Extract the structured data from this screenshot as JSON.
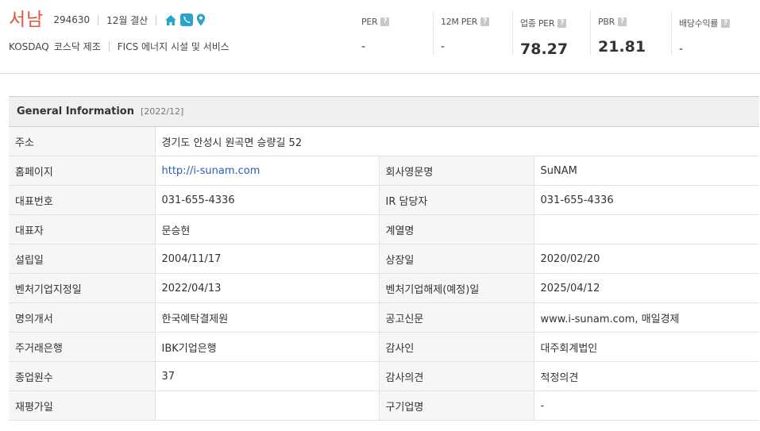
{
  "header": {
    "company_name": "서남",
    "code": "294630",
    "settlement": "12월 결산",
    "market": "KOSDAQ",
    "sector_a": "코스닥 제조",
    "sector_b": "FICS 에너지 시설 및 서비스"
  },
  "icons": {
    "home": "home-icon",
    "phone": "phone-icon",
    "map": "map-pin-icon"
  },
  "colors": {
    "company": "#e4533e",
    "link": "#2b5fb4",
    "section_bg": "#efefef"
  },
  "metrics": [
    {
      "label": "PER",
      "value": "-"
    },
    {
      "label": "12M PER",
      "value": "-"
    },
    {
      "label": "업종 PER",
      "value": "78.27"
    },
    {
      "label": "PBR",
      "value": "21.81"
    },
    {
      "label": "배당수익률",
      "value": "-"
    }
  ],
  "help_glyph": "?",
  "section": {
    "title": "General Information",
    "date": "[2022/12]"
  },
  "info": {
    "address_label": "주소",
    "address": "경기도 안성시 원곡면 승량길 52",
    "rows": [
      {
        "l1": "홈페이지",
        "v1": "http://i-sunam.com",
        "l2": "회사영문명",
        "v2": "SuNAM"
      },
      {
        "l1": "대표번호",
        "v1": "031-655-4336",
        "l2": "IR 담당자",
        "v2": "031-655-4336"
      },
      {
        "l1": "대표자",
        "v1": "문승현",
        "l2": "계열명",
        "v2": ""
      },
      {
        "l1": "설립일",
        "v1": "2004/11/17",
        "l2": "상장일",
        "v2": "2020/02/20"
      },
      {
        "l1": "벤처기업지정일",
        "v1": "2022/04/13",
        "l2": "벤처기업해제(예정)일",
        "v2": "2025/04/12"
      },
      {
        "l1": "명의개서",
        "v1": "한국예탁결제원",
        "l2": "공고신문",
        "v2": "www.i-sunam.com, 매일경제"
      },
      {
        "l1": "주거래은행",
        "v1": "IBK기업은행",
        "l2": "감사인",
        "v2": "대주회계법인"
      },
      {
        "l1": "종업원수",
        "v1": "37",
        "l2": "감사의견",
        "v2": "적정의견"
      },
      {
        "l1": "재평가일",
        "v1": "",
        "l2": "구기업명",
        "v2": "-"
      }
    ]
  }
}
